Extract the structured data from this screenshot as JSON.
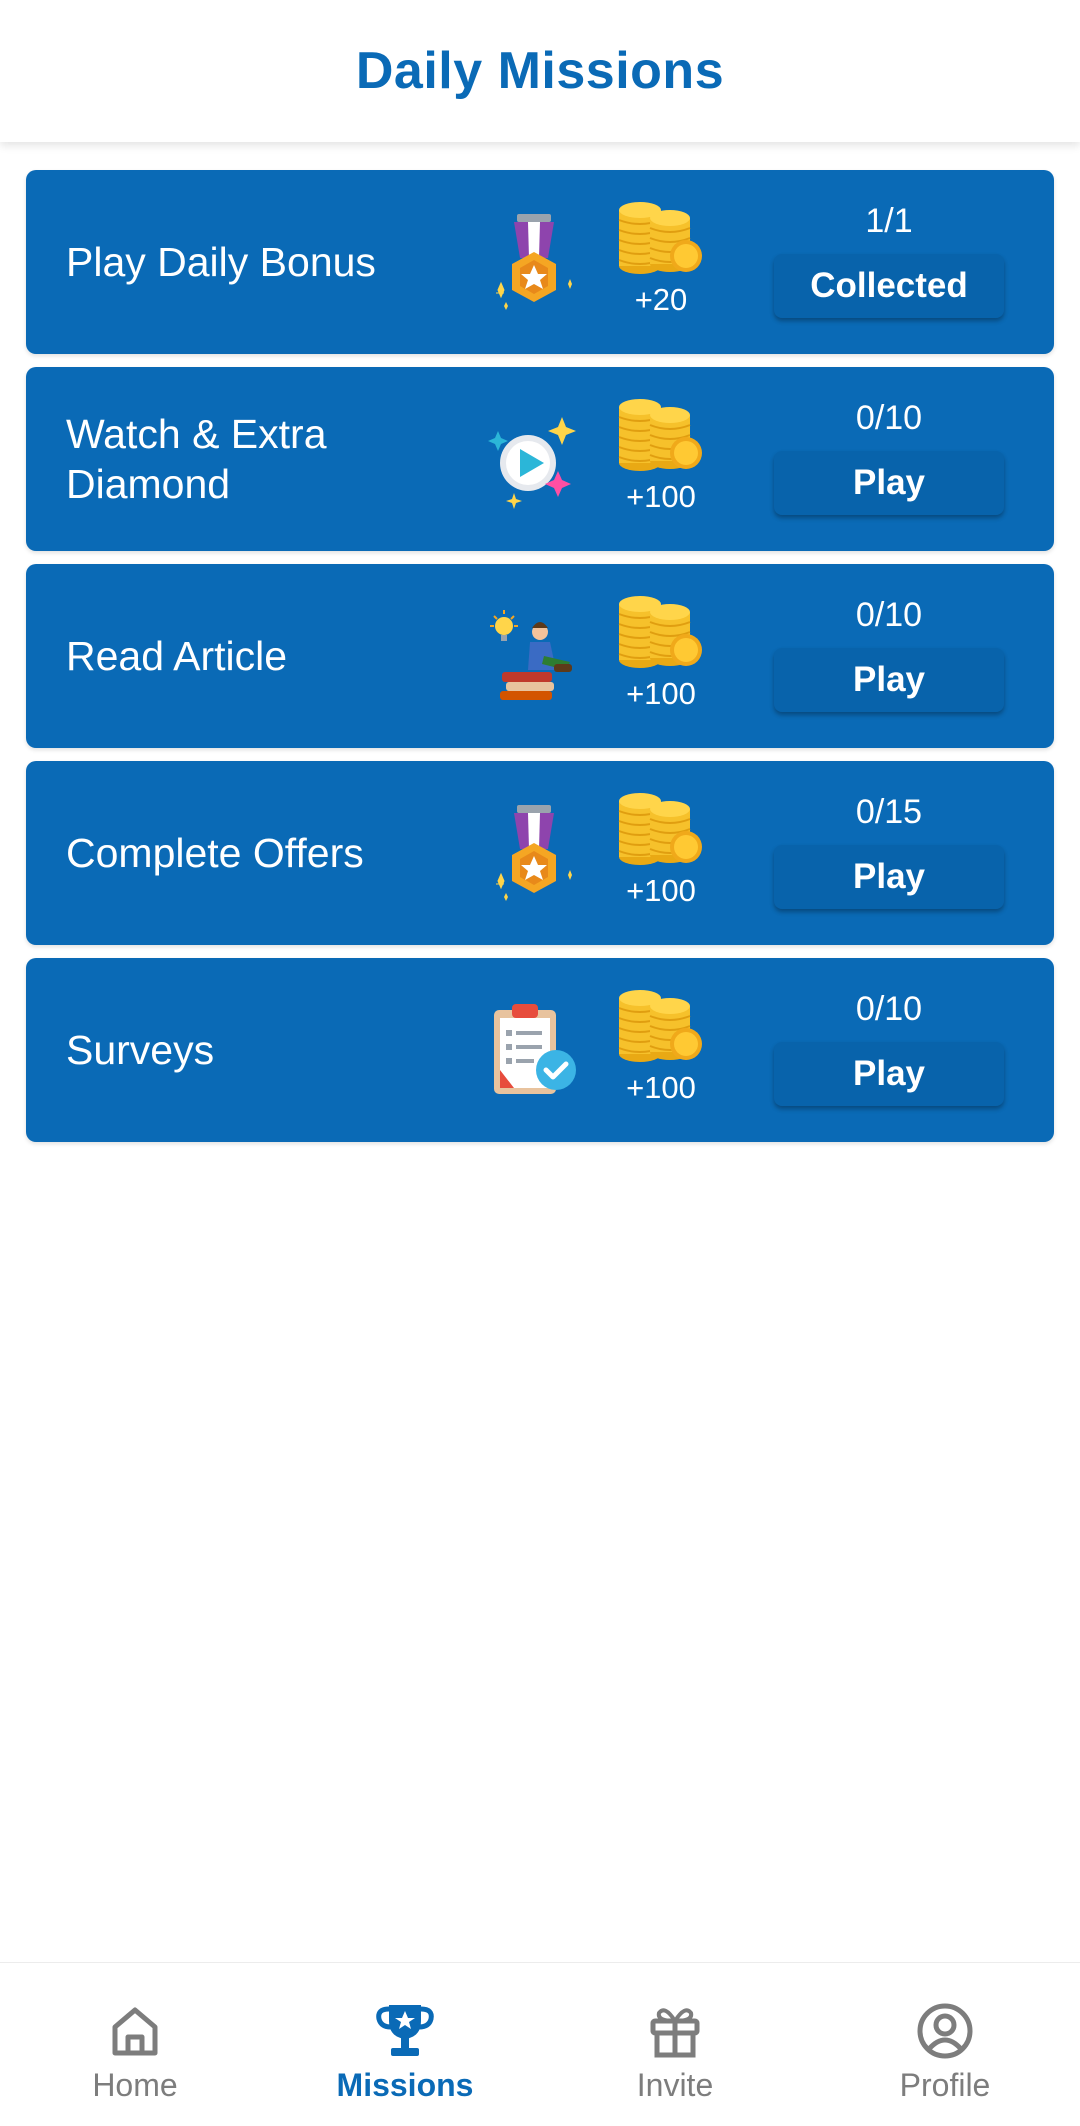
{
  "header": {
    "title": "Daily Missions"
  },
  "missions": [
    {
      "title": "Play Daily Bonus",
      "icon": "medal-icon",
      "reward": "+20",
      "progress": "1/1",
      "action": "Collected"
    },
    {
      "title": "Watch & Extra Diamond",
      "icon": "video-play-icon",
      "reward": "+100",
      "progress": "0/10",
      "action": "Play"
    },
    {
      "title": "Read Article",
      "icon": "reading-icon",
      "reward": "+100",
      "progress": "0/10",
      "action": "Play"
    },
    {
      "title": "Complete Offers",
      "icon": "medal-icon",
      "reward": "+100",
      "progress": "0/15",
      "action": "Play"
    },
    {
      "title": "Surveys",
      "icon": "clipboard-check-icon",
      "reward": "+100",
      "progress": "0/10",
      "action": "Play"
    }
  ],
  "nav": {
    "items": [
      {
        "label": "Home",
        "icon": "home-icon",
        "active": false
      },
      {
        "label": "Missions",
        "icon": "trophy-icon",
        "active": true
      },
      {
        "label": "Invite",
        "icon": "gift-icon",
        "active": false
      },
      {
        "label": "Profile",
        "icon": "profile-icon",
        "active": false
      }
    ]
  },
  "colors": {
    "primary": "#0a6ab6",
    "button": "#0863ab",
    "nav_inactive": "#7d7d7d",
    "coin": "#f6c12b"
  }
}
